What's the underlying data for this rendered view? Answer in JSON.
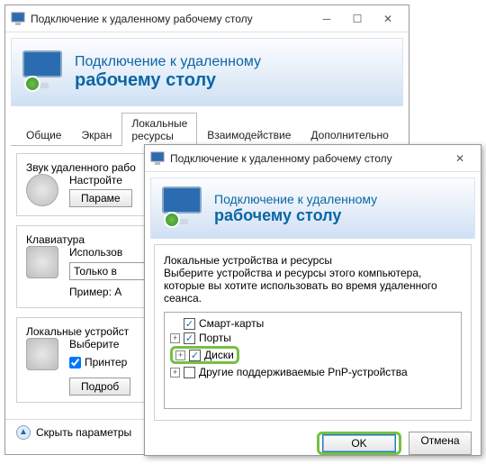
{
  "backWindow": {
    "title": "Подключение к удаленному рабочему столу",
    "bannerLine1": "Подключение к удаленному",
    "bannerLine2": "рабочему столу",
    "tabs": [
      "Общие",
      "Экран",
      "Локальные ресурсы",
      "Взаимодействие",
      "Дополнительно"
    ],
    "activeTab": 2,
    "group1": {
      "legend": "Звук удаленного рабо",
      "line1": "Настройте",
      "button": "Параме"
    },
    "group2": {
      "legend": "Клавиатура",
      "line1": "Использов",
      "combo": "Только в",
      "line2": "Пример: A"
    },
    "group3": {
      "legend": "Локальные устройст",
      "line1": "Выберите",
      "checkPrinters": "Принтер",
      "button": "Подроб"
    },
    "footerLink": "Скрыть параметры"
  },
  "frontWindow": {
    "title": "Подключение к удаленному рабочему столу",
    "bannerLine1": "Подключение к удаленному",
    "bannerLine2": "рабочему столу",
    "groupLegend": "Локальные устройства и ресурсы",
    "desc": "Выберите устройства и ресурсы этого компьютера, которые вы хотите использовать во время удаленного сеанса.",
    "tree": {
      "smartCards": {
        "label": "Смарт-карты",
        "checked": true,
        "expander": null
      },
      "ports": {
        "label": "Порты",
        "checked": true,
        "expander": "+"
      },
      "disks": {
        "label": "Диски",
        "checked": true,
        "expander": "+"
      },
      "pnp": {
        "label": "Другие поддерживаемые PnP-устройства",
        "checked": false,
        "expander": "+"
      }
    },
    "ok": "OK",
    "cancel": "Отмена"
  }
}
